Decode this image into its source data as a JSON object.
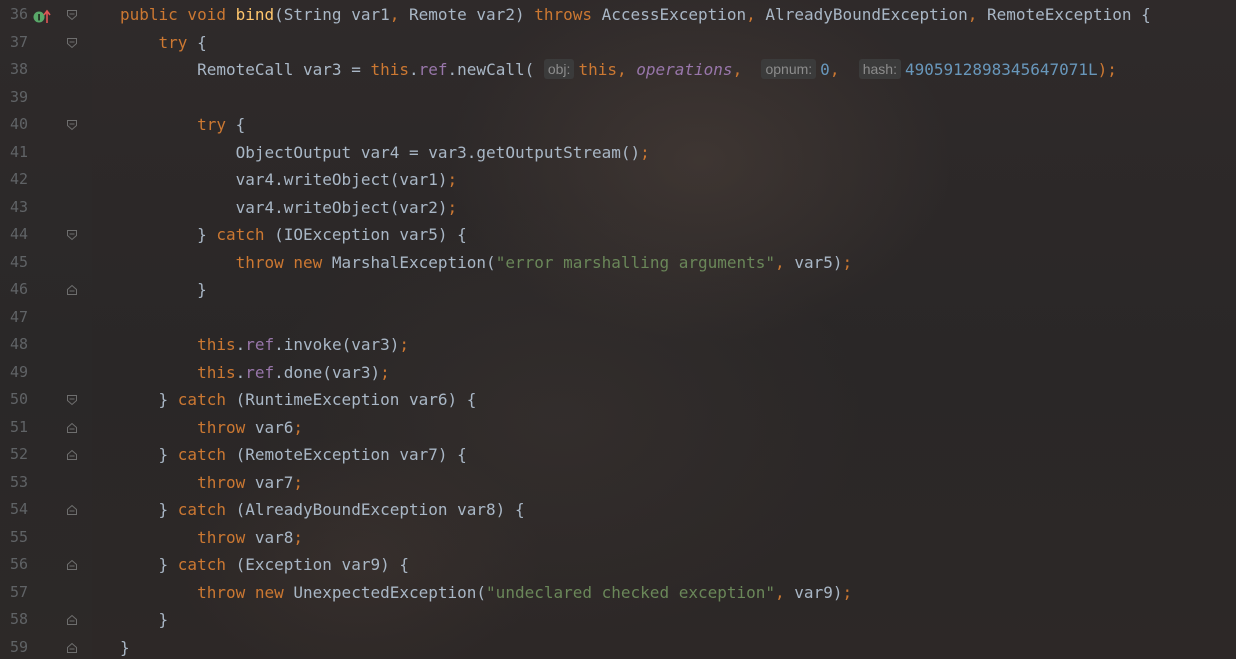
{
  "editor": {
    "lines": [
      {
        "number": "36",
        "fold": "open",
        "marker": true,
        "tokens": [
          {
            "t": "public void ",
            "c": "kw"
          },
          {
            "t": "bind",
            "c": "fn"
          },
          {
            "t": "(String var1",
            "c": "id"
          },
          {
            "t": ", ",
            "c": "punc"
          },
          {
            "t": "Remote var2) ",
            "c": "id"
          },
          {
            "t": "throws ",
            "c": "kw"
          },
          {
            "t": "AccessException",
            "c": "id"
          },
          {
            "t": ", ",
            "c": "punc"
          },
          {
            "t": "AlreadyBoundException",
            "c": "id"
          },
          {
            "t": ", ",
            "c": "punc"
          },
          {
            "t": "RemoteException {",
            "c": "id"
          }
        ]
      },
      {
        "number": "37",
        "fold": "open",
        "tokens": [
          {
            "t": "    ",
            "c": "id"
          },
          {
            "t": "try ",
            "c": "kw"
          },
          {
            "t": "{",
            "c": "id"
          }
        ]
      },
      {
        "number": "38",
        "fold": "",
        "tokens": [
          {
            "t": "        RemoteCall var3 = ",
            "c": "id"
          },
          {
            "t": "this",
            "c": "kw"
          },
          {
            "t": ".",
            "c": "id"
          },
          {
            "t": "ref",
            "c": "field"
          },
          {
            "t": ".newCall( ",
            "c": "id"
          },
          {
            "t": "obj:",
            "c": "hint"
          },
          {
            "t": "this",
            "c": "kw"
          },
          {
            "t": ", ",
            "c": "punc"
          },
          {
            "t": "operations",
            "c": "fieldi"
          },
          {
            "t": ",  ",
            "c": "punc"
          },
          {
            "t": "opnum:",
            "c": "hint"
          },
          {
            "t": "0",
            "c": "num"
          },
          {
            "t": ",  ",
            "c": "punc"
          },
          {
            "t": "hash:",
            "c": "hint"
          },
          {
            "t": "4905912898345647071L",
            "c": "num"
          },
          {
            "t": ");",
            "c": "punc"
          }
        ]
      },
      {
        "number": "39",
        "fold": "",
        "tokens": []
      },
      {
        "number": "40",
        "fold": "open",
        "tokens": [
          {
            "t": "        ",
            "c": "id"
          },
          {
            "t": "try ",
            "c": "kw"
          },
          {
            "t": "{",
            "c": "id"
          }
        ]
      },
      {
        "number": "41",
        "fold": "",
        "tokens": [
          {
            "t": "            ObjectOutput var4 = var3.getOutputStream()",
            "c": "id"
          },
          {
            "t": ";",
            "c": "punc"
          }
        ]
      },
      {
        "number": "42",
        "fold": "",
        "tokens": [
          {
            "t": "            var4.writeObject(var1)",
            "c": "id"
          },
          {
            "t": ";",
            "c": "punc"
          }
        ]
      },
      {
        "number": "43",
        "fold": "",
        "tokens": [
          {
            "t": "            var4.writeObject(var2)",
            "c": "id"
          },
          {
            "t": ";",
            "c": "punc"
          }
        ]
      },
      {
        "number": "44",
        "fold": "open",
        "tokens": [
          {
            "t": "        } ",
            "c": "id"
          },
          {
            "t": "catch ",
            "c": "kw"
          },
          {
            "t": "(IOException var5) {",
            "c": "id"
          }
        ]
      },
      {
        "number": "45",
        "fold": "",
        "tokens": [
          {
            "t": "            ",
            "c": "id"
          },
          {
            "t": "throw new ",
            "c": "kw"
          },
          {
            "t": "MarshalException(",
            "c": "id"
          },
          {
            "t": "\"error marshalling arguments\"",
            "c": "str"
          },
          {
            "t": ", ",
            "c": "punc"
          },
          {
            "t": "var5)",
            "c": "id"
          },
          {
            "t": ";",
            "c": "punc"
          }
        ]
      },
      {
        "number": "46",
        "fold": "close",
        "tokens": [
          {
            "t": "        }",
            "c": "id"
          }
        ]
      },
      {
        "number": "47",
        "fold": "",
        "tokens": []
      },
      {
        "number": "48",
        "fold": "",
        "tokens": [
          {
            "t": "        ",
            "c": "id"
          },
          {
            "t": "this",
            "c": "kw"
          },
          {
            "t": ".",
            "c": "id"
          },
          {
            "t": "ref",
            "c": "field"
          },
          {
            "t": ".invoke(var3)",
            "c": "id"
          },
          {
            "t": ";",
            "c": "punc"
          }
        ]
      },
      {
        "number": "49",
        "fold": "",
        "tokens": [
          {
            "t": "        ",
            "c": "id"
          },
          {
            "t": "this",
            "c": "kw"
          },
          {
            "t": ".",
            "c": "id"
          },
          {
            "t": "ref",
            "c": "field"
          },
          {
            "t": ".done(var3)",
            "c": "id"
          },
          {
            "t": ";",
            "c": "punc"
          }
        ]
      },
      {
        "number": "50",
        "fold": "open",
        "tokens": [
          {
            "t": "    } ",
            "c": "id"
          },
          {
            "t": "catch ",
            "c": "kw"
          },
          {
            "t": "(RuntimeException var6) {",
            "c": "id"
          }
        ]
      },
      {
        "number": "51",
        "fold": "close",
        "tokens": [
          {
            "t": "        ",
            "c": "id"
          },
          {
            "t": "throw ",
            "c": "kw"
          },
          {
            "t": "var6",
            "c": "id"
          },
          {
            "t": ";",
            "c": "punc"
          }
        ]
      },
      {
        "number": "52",
        "fold": "close",
        "tokens": [
          {
            "t": "    } ",
            "c": "id"
          },
          {
            "t": "catch ",
            "c": "kw"
          },
          {
            "t": "(RemoteException var7) {",
            "c": "id"
          }
        ]
      },
      {
        "number": "53",
        "fold": "",
        "tokens": [
          {
            "t": "        ",
            "c": "id"
          },
          {
            "t": "throw ",
            "c": "kw"
          },
          {
            "t": "var7",
            "c": "id"
          },
          {
            "t": ";",
            "c": "punc"
          }
        ]
      },
      {
        "number": "54",
        "fold": "close",
        "tokens": [
          {
            "t": "    } ",
            "c": "id"
          },
          {
            "t": "catch ",
            "c": "kw"
          },
          {
            "t": "(AlreadyBoundException var8) {",
            "c": "id"
          }
        ]
      },
      {
        "number": "55",
        "fold": "",
        "tokens": [
          {
            "t": "        ",
            "c": "id"
          },
          {
            "t": "throw ",
            "c": "kw"
          },
          {
            "t": "var8",
            "c": "id"
          },
          {
            "t": ";",
            "c": "punc"
          }
        ]
      },
      {
        "number": "56",
        "fold": "close",
        "tokens": [
          {
            "t": "    } ",
            "c": "id"
          },
          {
            "t": "catch ",
            "c": "kw"
          },
          {
            "t": "(Exception var9) {",
            "c": "id"
          }
        ]
      },
      {
        "number": "57",
        "fold": "",
        "tokens": [
          {
            "t": "        ",
            "c": "id"
          },
          {
            "t": "throw new ",
            "c": "kw"
          },
          {
            "t": "UnexpectedException(",
            "c": "id"
          },
          {
            "t": "\"undeclared checked exception\"",
            "c": "str"
          },
          {
            "t": ", ",
            "c": "punc"
          },
          {
            "t": "var9)",
            "c": "id"
          },
          {
            "t": ";",
            "c": "punc"
          }
        ]
      },
      {
        "number": "58",
        "fold": "close",
        "tokens": [
          {
            "t": "    }",
            "c": "id"
          }
        ]
      },
      {
        "number": "59",
        "fold": "close",
        "tokens": [
          {
            "t": "}",
            "c": "id"
          }
        ]
      }
    ]
  },
  "colors": {
    "keyword": "#cc7832",
    "method": "#ffc66d",
    "field": "#9876aa",
    "string": "#6a8759",
    "number": "#6897bb",
    "text": "#a9b7c6",
    "line_number": "#606366",
    "hint_bg": "#3b3b3b",
    "marker_green": "#59a869",
    "marker_red": "#e05555"
  }
}
